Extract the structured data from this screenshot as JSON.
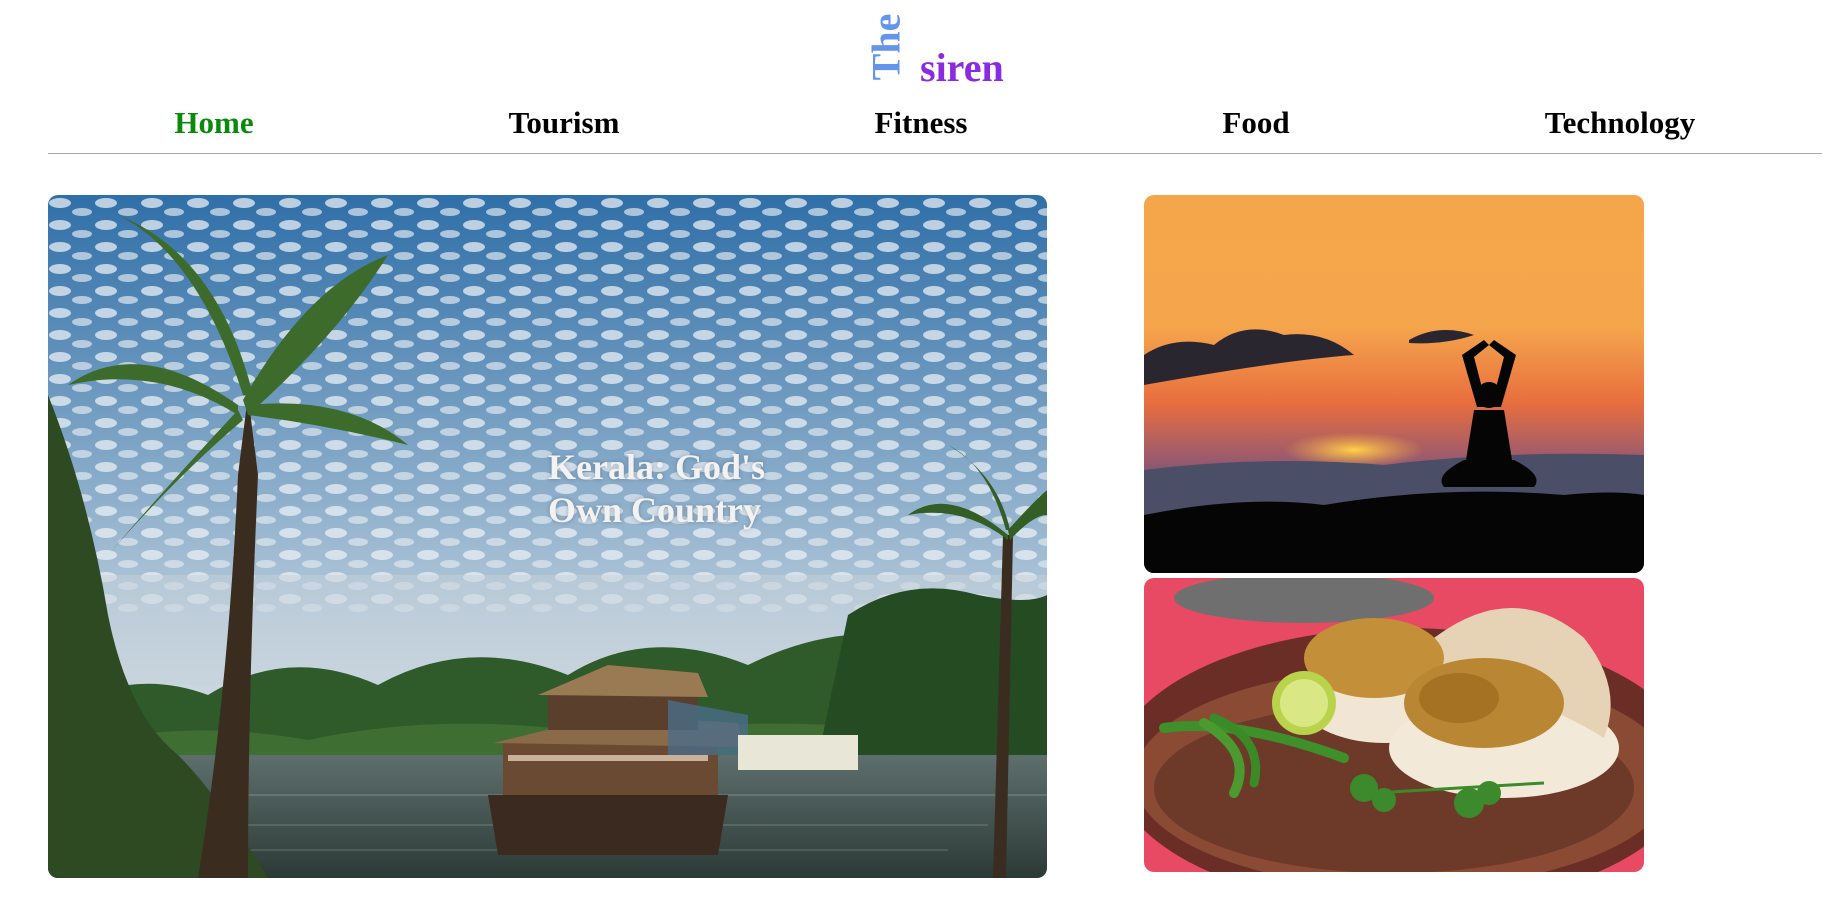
{
  "brand": {
    "part1": "The",
    "part2": "siren"
  },
  "nav": {
    "items": [
      {
        "label": "Home",
        "active": true
      },
      {
        "label": "Tourism",
        "active": false
      },
      {
        "label": "Fitness",
        "active": false
      },
      {
        "label": "Food",
        "active": false
      },
      {
        "label": "Technology",
        "active": false
      }
    ]
  },
  "featured": {
    "caption": "Kerala: God's Own Country",
    "image": "kerala-backwaters-houseboat"
  },
  "side_cards": [
    {
      "image": "yoga-silhouette-sunset"
    },
    {
      "image": "vada-pav-plate"
    }
  ],
  "colors": {
    "brand_the": "#6495ed",
    "brand_siren": "#8a2be2",
    "nav_active": "#0a8a0a",
    "nav_default": "#000000",
    "divider": "#aaaaaa"
  }
}
